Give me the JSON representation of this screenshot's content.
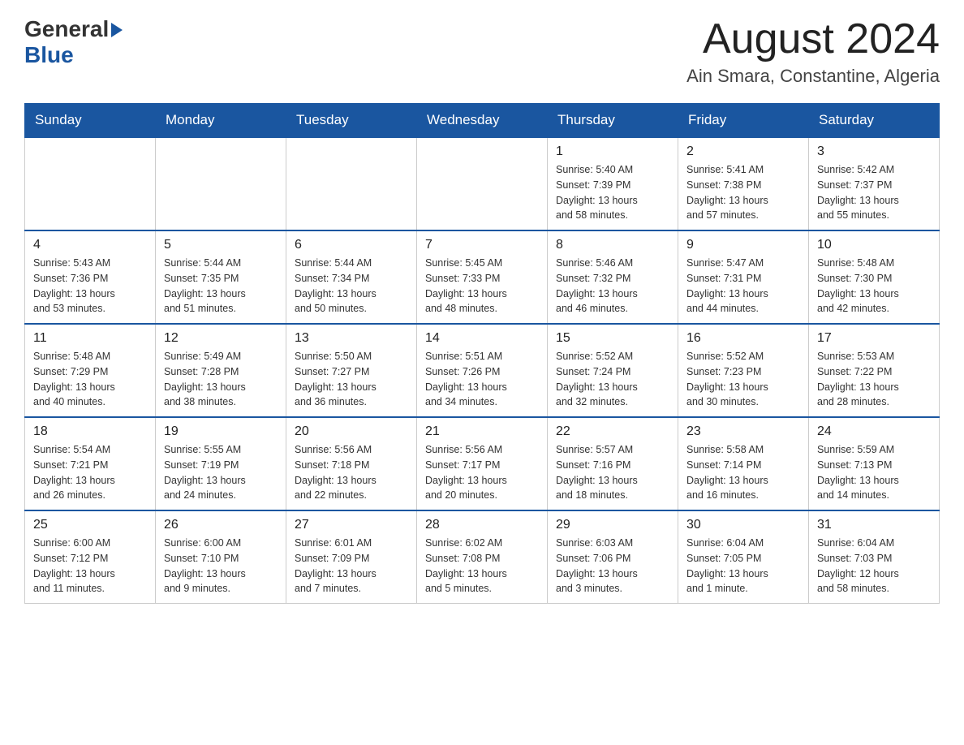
{
  "header": {
    "logo_general": "General",
    "logo_blue": "Blue",
    "title": "August 2024",
    "subtitle": "Ain Smara, Constantine, Algeria"
  },
  "calendar": {
    "weekdays": [
      "Sunday",
      "Monday",
      "Tuesday",
      "Wednesday",
      "Thursday",
      "Friday",
      "Saturday"
    ],
    "weeks": [
      [
        {
          "day": "",
          "info": ""
        },
        {
          "day": "",
          "info": ""
        },
        {
          "day": "",
          "info": ""
        },
        {
          "day": "",
          "info": ""
        },
        {
          "day": "1",
          "info": "Sunrise: 5:40 AM\nSunset: 7:39 PM\nDaylight: 13 hours\nand 58 minutes."
        },
        {
          "day": "2",
          "info": "Sunrise: 5:41 AM\nSunset: 7:38 PM\nDaylight: 13 hours\nand 57 minutes."
        },
        {
          "day": "3",
          "info": "Sunrise: 5:42 AM\nSunset: 7:37 PM\nDaylight: 13 hours\nand 55 minutes."
        }
      ],
      [
        {
          "day": "4",
          "info": "Sunrise: 5:43 AM\nSunset: 7:36 PM\nDaylight: 13 hours\nand 53 minutes."
        },
        {
          "day": "5",
          "info": "Sunrise: 5:44 AM\nSunset: 7:35 PM\nDaylight: 13 hours\nand 51 minutes."
        },
        {
          "day": "6",
          "info": "Sunrise: 5:44 AM\nSunset: 7:34 PM\nDaylight: 13 hours\nand 50 minutes."
        },
        {
          "day": "7",
          "info": "Sunrise: 5:45 AM\nSunset: 7:33 PM\nDaylight: 13 hours\nand 48 minutes."
        },
        {
          "day": "8",
          "info": "Sunrise: 5:46 AM\nSunset: 7:32 PM\nDaylight: 13 hours\nand 46 minutes."
        },
        {
          "day": "9",
          "info": "Sunrise: 5:47 AM\nSunset: 7:31 PM\nDaylight: 13 hours\nand 44 minutes."
        },
        {
          "day": "10",
          "info": "Sunrise: 5:48 AM\nSunset: 7:30 PM\nDaylight: 13 hours\nand 42 minutes."
        }
      ],
      [
        {
          "day": "11",
          "info": "Sunrise: 5:48 AM\nSunset: 7:29 PM\nDaylight: 13 hours\nand 40 minutes."
        },
        {
          "day": "12",
          "info": "Sunrise: 5:49 AM\nSunset: 7:28 PM\nDaylight: 13 hours\nand 38 minutes."
        },
        {
          "day": "13",
          "info": "Sunrise: 5:50 AM\nSunset: 7:27 PM\nDaylight: 13 hours\nand 36 minutes."
        },
        {
          "day": "14",
          "info": "Sunrise: 5:51 AM\nSunset: 7:26 PM\nDaylight: 13 hours\nand 34 minutes."
        },
        {
          "day": "15",
          "info": "Sunrise: 5:52 AM\nSunset: 7:24 PM\nDaylight: 13 hours\nand 32 minutes."
        },
        {
          "day": "16",
          "info": "Sunrise: 5:52 AM\nSunset: 7:23 PM\nDaylight: 13 hours\nand 30 minutes."
        },
        {
          "day": "17",
          "info": "Sunrise: 5:53 AM\nSunset: 7:22 PM\nDaylight: 13 hours\nand 28 minutes."
        }
      ],
      [
        {
          "day": "18",
          "info": "Sunrise: 5:54 AM\nSunset: 7:21 PM\nDaylight: 13 hours\nand 26 minutes."
        },
        {
          "day": "19",
          "info": "Sunrise: 5:55 AM\nSunset: 7:19 PM\nDaylight: 13 hours\nand 24 minutes."
        },
        {
          "day": "20",
          "info": "Sunrise: 5:56 AM\nSunset: 7:18 PM\nDaylight: 13 hours\nand 22 minutes."
        },
        {
          "day": "21",
          "info": "Sunrise: 5:56 AM\nSunset: 7:17 PM\nDaylight: 13 hours\nand 20 minutes."
        },
        {
          "day": "22",
          "info": "Sunrise: 5:57 AM\nSunset: 7:16 PM\nDaylight: 13 hours\nand 18 minutes."
        },
        {
          "day": "23",
          "info": "Sunrise: 5:58 AM\nSunset: 7:14 PM\nDaylight: 13 hours\nand 16 minutes."
        },
        {
          "day": "24",
          "info": "Sunrise: 5:59 AM\nSunset: 7:13 PM\nDaylight: 13 hours\nand 14 minutes."
        }
      ],
      [
        {
          "day": "25",
          "info": "Sunrise: 6:00 AM\nSunset: 7:12 PM\nDaylight: 13 hours\nand 11 minutes."
        },
        {
          "day": "26",
          "info": "Sunrise: 6:00 AM\nSunset: 7:10 PM\nDaylight: 13 hours\nand 9 minutes."
        },
        {
          "day": "27",
          "info": "Sunrise: 6:01 AM\nSunset: 7:09 PM\nDaylight: 13 hours\nand 7 minutes."
        },
        {
          "day": "28",
          "info": "Sunrise: 6:02 AM\nSunset: 7:08 PM\nDaylight: 13 hours\nand 5 minutes."
        },
        {
          "day": "29",
          "info": "Sunrise: 6:03 AM\nSunset: 7:06 PM\nDaylight: 13 hours\nand 3 minutes."
        },
        {
          "day": "30",
          "info": "Sunrise: 6:04 AM\nSunset: 7:05 PM\nDaylight: 13 hours\nand 1 minute."
        },
        {
          "day": "31",
          "info": "Sunrise: 6:04 AM\nSunset: 7:03 PM\nDaylight: 12 hours\nand 58 minutes."
        }
      ]
    ]
  }
}
